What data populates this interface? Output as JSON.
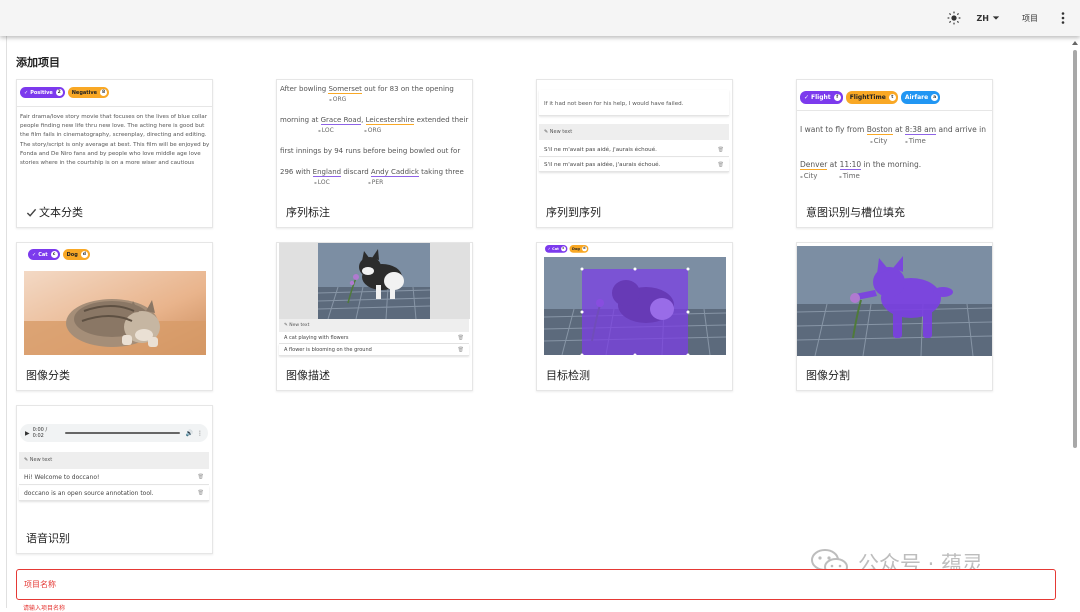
{
  "topbar": {
    "theme_icon": "sun-icon",
    "language": "ZH",
    "projects_label": "项目",
    "more_icon": "more-vertical-icon"
  },
  "page": {
    "title": "添加项目"
  },
  "cards": {
    "text_classification": {
      "caption": "文本分类",
      "chips": [
        {
          "label": "Positive",
          "count": "2"
        },
        {
          "label": "Negative",
          "count": "8"
        }
      ],
      "text": "Fair drama/love story movie that focuses on the lives of blue collar people finding new life thru new love. The acting here is good but the film fails in cinematography, screenplay, directing and editing. The story/script is only average at best. This film will be enjoyed by Fonda and De Niro fans and by people who love middle age love stories where in the courtship is on a more wiser and cautious"
    },
    "sequence_labeling": {
      "caption": "序列标注",
      "line1_a": "After bowling ",
      "line1_e1": "Somerset",
      "line1_b": " out for 83 on the opening",
      "line1_tag": "ORG",
      "line2_a": "morning at ",
      "line2_e1": "Grace Road",
      "line2_b": ", ",
      "line2_e2": "Leicestershire",
      "line2_c": " extended their",
      "line2_tag1": "LOC",
      "line2_tag2": "ORG",
      "line3": "first innings by 94 runs before being bowled out for",
      "line4_a": "296 with ",
      "line4_e1": "England",
      "line4_b": " discard ",
      "line4_e2": "Andy Caddick",
      "line4_c": " taking three",
      "line4_tag1": "LOC",
      "line4_tag2": "PER"
    },
    "seq2seq": {
      "caption": "序列到序列",
      "source": "If it had not been for his help, I would have failed.",
      "new_text": "New text",
      "rows": [
        "S'il ne m'avait pas aidé, j'aurais échoué.",
        "S'il ne m'avait pas aidée, j'aurais échoué."
      ]
    },
    "intent_slot": {
      "caption": "意图识别与槽位填充",
      "chips": [
        {
          "label": "Flight",
          "count": "f"
        },
        {
          "label": "FlightTime",
          "count": "t"
        },
        {
          "label": "Airfare",
          "count": "a"
        }
      ],
      "line1_a": "I want to fly from ",
      "line1_e1": "Boston",
      "line1_b": " at ",
      "line1_e2": "8:38 am",
      "line1_c": " and arrive in",
      "line1_tag1": "City",
      "line1_tag2": "Time",
      "line2_e1": "Denver",
      "line2_a": " at ",
      "line2_e2": "11:10",
      "line2_b": " in the morning.",
      "line2_tag1": "City",
      "line2_tag2": "Time"
    },
    "image_classification": {
      "caption": "图像分类",
      "chips": [
        {
          "label": "Cat",
          "count": "c"
        },
        {
          "label": "Dog",
          "count": "d"
        }
      ]
    },
    "image_captioning": {
      "caption": "图像描述",
      "new_text": "New text",
      "rows": [
        "A cat playing with flowers",
        "A flower is blooming on the ground"
      ]
    },
    "object_detection": {
      "caption": "目标检测",
      "chips": [
        {
          "label": "Cat",
          "count": "c"
        },
        {
          "label": "Dog",
          "count": "d"
        }
      ]
    },
    "segmentation": {
      "caption": "图像分割"
    },
    "speech_recognition": {
      "caption": "语音识别",
      "time": "0:00 / 0:02",
      "new_text": "New text",
      "rows": [
        "Hi! Welcome to doccano!",
        "doccano is an open source annotation tool."
      ]
    }
  },
  "form": {
    "project_name_label": "项目名称",
    "error_text": "请输入项目名称"
  },
  "watermark": {
    "text": "公众号 · 蕴灵"
  },
  "colors": {
    "purple": "#7c3aed",
    "orange": "#f9a825",
    "blue": "#2196f3",
    "error": "#e53935"
  }
}
